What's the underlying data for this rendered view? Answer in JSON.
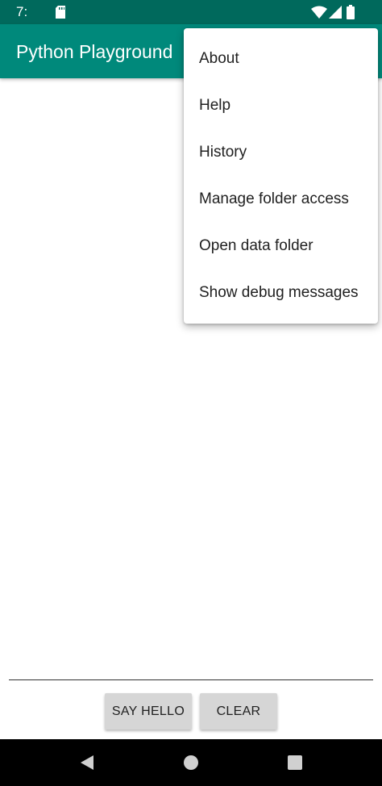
{
  "status_bar": {
    "time": "7:",
    "icons": [
      "sd-card-icon",
      "wifi-icon",
      "cell-signal-icon",
      "battery-icon"
    ]
  },
  "app_bar": {
    "title": "Python Playground"
  },
  "overflow_menu": {
    "items": [
      {
        "label": "About"
      },
      {
        "label": "Help"
      },
      {
        "label": "History"
      },
      {
        "label": "Manage folder access"
      },
      {
        "label": "Open data folder"
      },
      {
        "label": "Show debug messages"
      }
    ]
  },
  "buttons": {
    "say_hello": "SAY HELLO",
    "clear": "CLEAR"
  },
  "nav_bar": {
    "icons": [
      "back-icon",
      "home-icon",
      "recents-icon"
    ]
  },
  "colors": {
    "status_bar": "#00695c",
    "app_bar": "#00897b",
    "button_bg": "#d6d6d6",
    "menu_bg": "#ffffff",
    "nav_bar": "#000000"
  }
}
